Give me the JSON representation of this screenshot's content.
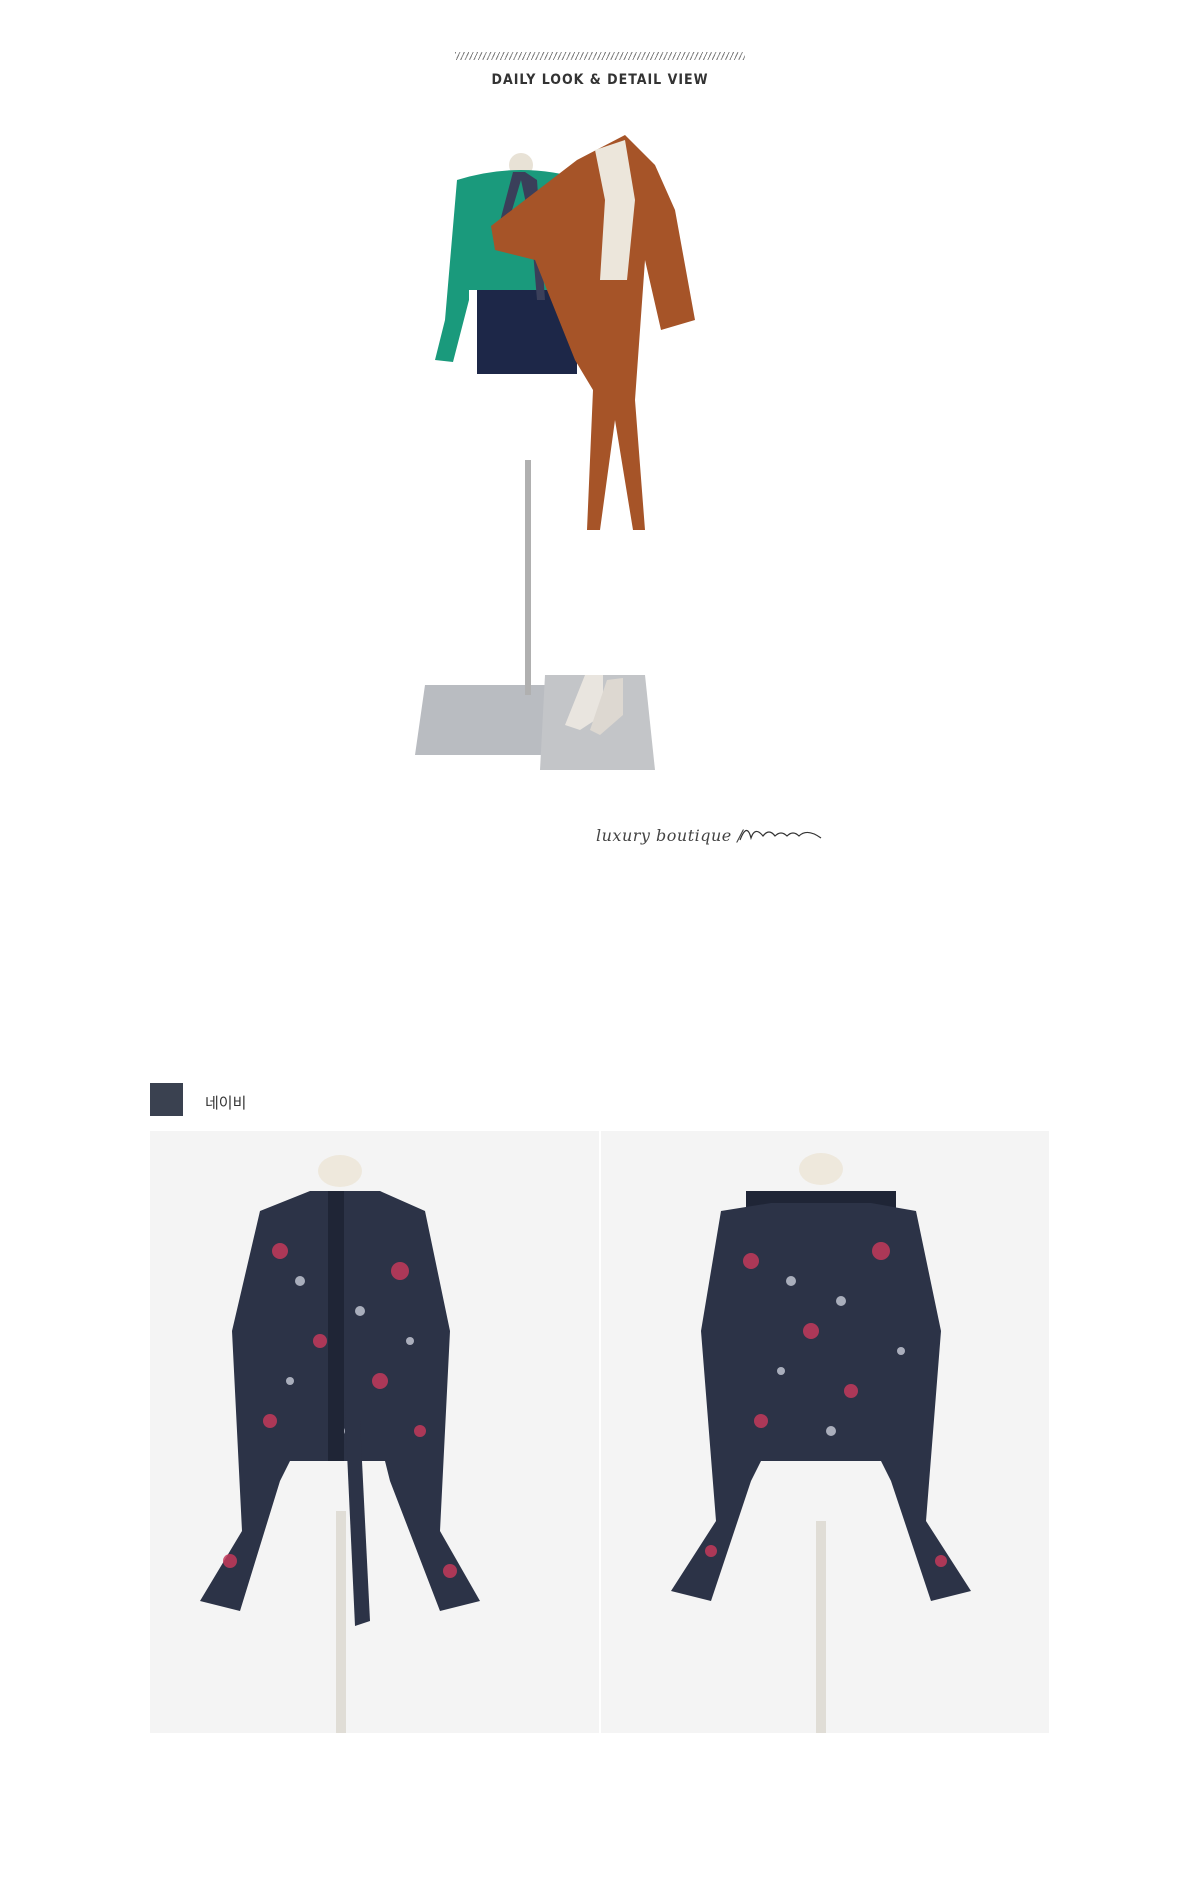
{
  "header": {
    "title": "DAILY LOOK & DETAIL VIEW"
  },
  "hero": {
    "tagline": "luxury boutique  /",
    "signature_text": "Jblanc"
  },
  "colors": {
    "swatch": "#3a4150",
    "teal": "#1a9a7c",
    "rust": "#a65428",
    "floral_base": "#2c3347",
    "floral_pink": "#c33a5b",
    "floral_white": "#dfe3ee"
  },
  "color_option": {
    "label": "네이비"
  },
  "icons": {
    "header_rule": "diagonal-line-rule",
    "signature": "handwritten-signature"
  }
}
